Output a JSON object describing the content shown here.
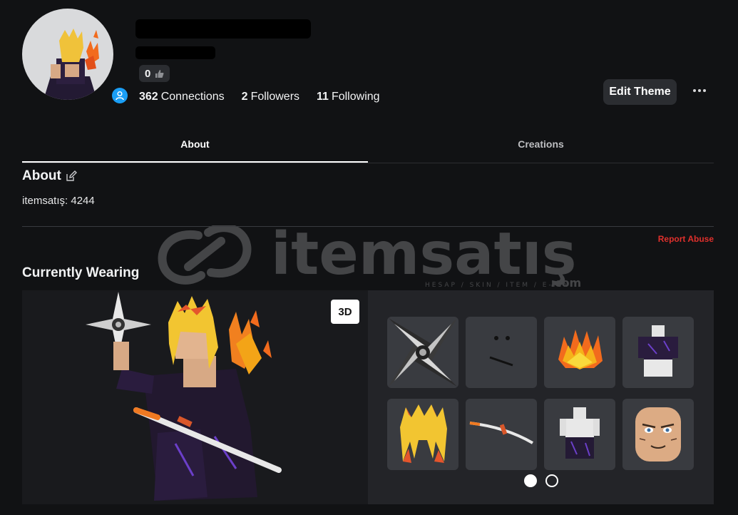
{
  "profile": {
    "likes_count": "0",
    "stats": [
      {
        "value": "362",
        "label": "Connections"
      },
      {
        "value": "2",
        "label": "Followers"
      },
      {
        "value": "11",
        "label": "Following"
      }
    ],
    "edit_theme_label": "Edit Theme"
  },
  "tabs": [
    {
      "label": "About",
      "active": true
    },
    {
      "label": "Creations",
      "active": false
    }
  ],
  "about": {
    "title": "About",
    "text": "itemsatış: 4244",
    "report_label": "Report Abuse"
  },
  "watermark": {
    "brand": "itemsatış",
    "tagline": "HESAP / SKIN / ITEM / E-PIN",
    "suffix": ".com"
  },
  "wearing": {
    "title": "Currently Wearing",
    "toggle_label": "3D",
    "items": [
      {
        "name": "shuriken-item"
      },
      {
        "name": "face-item"
      },
      {
        "name": "flame-hair-item"
      },
      {
        "name": "shirt-item"
      },
      {
        "name": "blonde-hair-item"
      },
      {
        "name": "katana-item"
      },
      {
        "name": "pants-item"
      },
      {
        "name": "head-item"
      }
    ],
    "page_count": 2,
    "current_page": 1
  },
  "colors": {
    "background": "#111214",
    "panel": "#232428",
    "tile": "#393b40",
    "accent_presence": "#1a9ef5",
    "report": "#e0302c"
  }
}
